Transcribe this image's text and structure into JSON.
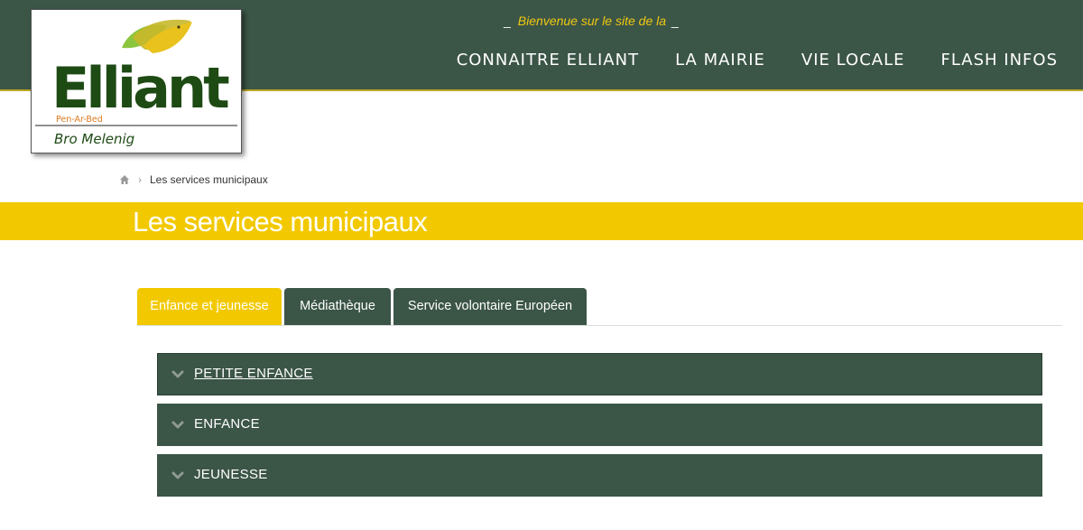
{
  "header": {
    "welcome_text": "Bienvenue sur le site de la",
    "nav": [
      {
        "label": "CONNAITRE ELLIANT"
      },
      {
        "label": "LA MAIRIE"
      },
      {
        "label": "VIE LOCALE"
      },
      {
        "label": "FLASH INFOS"
      }
    ]
  },
  "logo": {
    "name": "Elliant",
    "subtitle": "Pen-Ar-Bed",
    "tagline": "Bro Melenig"
  },
  "breadcrumb": {
    "current": "Les services municipaux"
  },
  "page": {
    "title": "Les services municipaux"
  },
  "tabs": [
    {
      "label": "Enfance et jeunesse",
      "active": true
    },
    {
      "label": "Médiathèque",
      "active": false
    },
    {
      "label": "Service volontaire Européen",
      "active": false
    }
  ],
  "accordion": [
    {
      "label": "PETITE ENFANCE"
    },
    {
      "label": "ENFANCE"
    },
    {
      "label": "JEUNESSE"
    }
  ],
  "colors": {
    "header_green": "#3b5547",
    "accent_yellow": "#f2c900",
    "welcome_yellow": "#f0c810"
  }
}
